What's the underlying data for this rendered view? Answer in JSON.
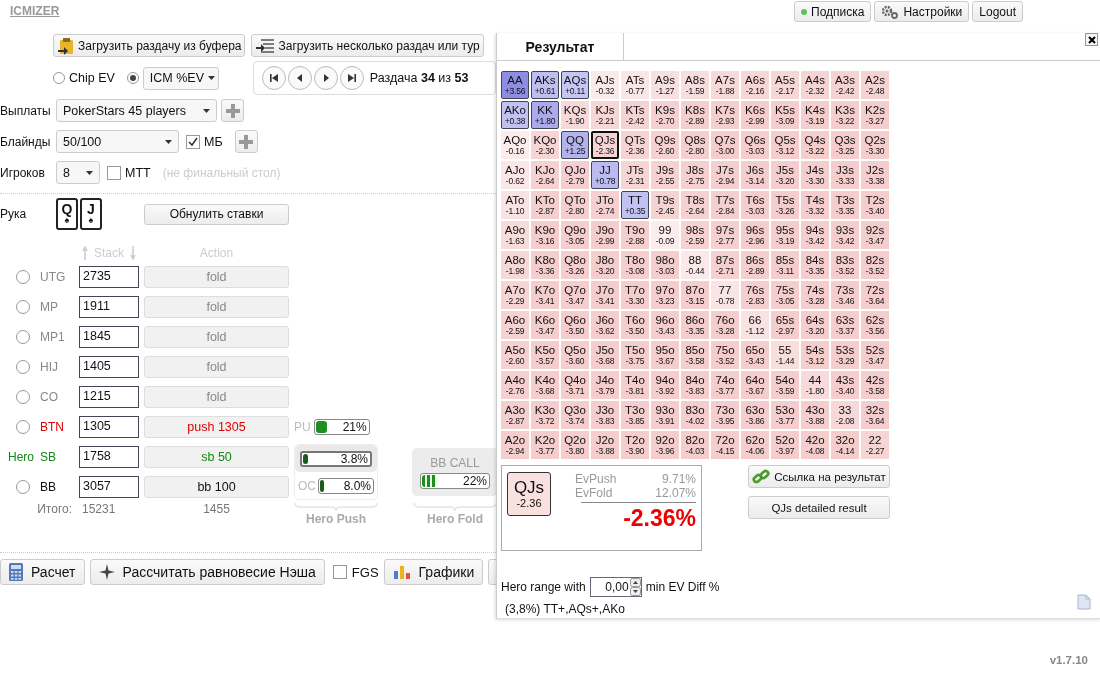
{
  "app": {
    "logo": "ICMIZER",
    "version": "v1.7.10"
  },
  "header_buttons": [
    {
      "label": "Подписка",
      "kind": "subscription"
    },
    {
      "label": "Настройки",
      "kind": "settings"
    },
    {
      "label": "Logout",
      "kind": "plain"
    }
  ],
  "load_buttons": [
    {
      "label": "Загрузить раздачу из буфера",
      "kind": "clipboard"
    },
    {
      "label": "Загрузить несколько раздач или тур",
      "kind": "list"
    }
  ],
  "ev_modes": [
    {
      "label": "Chip EV",
      "selected": false,
      "kind": "radio"
    },
    {
      "label": "ICM %EV",
      "selected": true,
      "kind": "dropdown"
    }
  ],
  "hand_nav": {
    "text": "Раздача **34** из **53**"
  },
  "payouts": {
    "label": "Выплаты",
    "value": "PokerStars 45 players"
  },
  "blinds": {
    "label": "Блайнды",
    "value": "50/100",
    "option": {
      "label": "МБ",
      "checked": true
    }
  },
  "players_count": {
    "label": "Игроков",
    "value": "8",
    "option": {
      "label": "MTT",
      "checked": false
    },
    "note": "(не финальный стол)"
  },
  "hand": {
    "label": "Рука",
    "cards": [
      {
        "rank": "Q",
        "suit": "♠"
      },
      {
        "rank": "J",
        "suit": "♠"
      }
    ],
    "reset_button": "Обнулить ставки"
  },
  "table": {
    "columns": [
      "Stack",
      "Action"
    ],
    "players": [
      {
        "position": "UTG",
        "stack": "2735",
        "action": "fold",
        "color": "#888888",
        "selected": false
      },
      {
        "position": "MP",
        "stack": "1911",
        "action": "fold",
        "color": "#888888",
        "selected": false
      },
      {
        "position": "MP1",
        "stack": "1845",
        "action": "fold",
        "color": "#888888",
        "selected": false
      },
      {
        "position": "HIJ",
        "stack": "1405",
        "action": "fold",
        "color": "#888888",
        "selected": false
      },
      {
        "position": "CO",
        "stack": "1215",
        "action": "fold",
        "color": "#888888",
        "selected": false
      },
      {
        "position": "BTN",
        "stack": "1305",
        "action": "push 1305",
        "color": "#e00000",
        "selected": false,
        "kind": "pusher"
      },
      {
        "position": "SB",
        "hero_label": "Hero",
        "stack": "1758",
        "action": "sb 50",
        "color": "#118811",
        "kind": "hero"
      },
      {
        "position": "BB",
        "stack": "3057",
        "action": "bb 100",
        "color": "#111111",
        "selected": false
      }
    ],
    "totals": {
      "label": "Итого:",
      "stack": "15231",
      "pot": "1455"
    }
  },
  "hero_push": {
    "title": "Hero Push",
    "range": {
      "label": "PU",
      "value": "21%",
      "level": 0.21
    },
    "push": {
      "value": "3.8%",
      "level": 0.038
    },
    "call": {
      "label": "OC",
      "value": "8.0%",
      "level": 0.08
    }
  },
  "hero_fold": {
    "title": "Hero Fold",
    "call": {
      "label": "BB CALL",
      "value": "22%",
      "level": 0.22
    }
  },
  "bottom_buttons": [
    {
      "label": "Расчет",
      "kind": "calculator"
    },
    {
      "label": "Рассчитать равновесие Нэша",
      "kind": "nash"
    },
    {
      "label": "FGS",
      "kind": "checkbox",
      "checked": false
    },
    {
      "label": "Графики",
      "kind": "charts"
    },
    {
      "kind": "export"
    }
  ],
  "result": {
    "tab": {
      "label": "Результат",
      "selected": true
    },
    "grid": [
      [
        {
          "h": "AA",
          "ev": "+3.56",
          "in_range": true,
          "selected": false
        },
        {
          "h": "AKs",
          "ev": "+0.61",
          "in_range": true,
          "selected": false
        },
        {
          "h": "AQs",
          "ev": "+0.11",
          "in_range": true,
          "selected": false
        },
        {
          "h": "AJs",
          "ev": "-0.32",
          "in_range": false,
          "selected": false
        },
        {
          "h": "ATs",
          "ev": "-0.77",
          "in_range": false,
          "selected": false
        },
        {
          "h": "A9s",
          "ev": "-1.27",
          "in_range": false,
          "selected": false
        },
        {
          "h": "A8s",
          "ev": "-1.59",
          "in_range": false,
          "selected": false
        },
        {
          "h": "A7s",
          "ev": "-1.88",
          "in_range": false,
          "selected": false
        },
        {
          "h": "A6s",
          "ev": "-2.16",
          "in_range": false,
          "selected": false
        },
        {
          "h": "A5s",
          "ev": "-2.17",
          "in_range": false,
          "selected": false
        },
        {
          "h": "A4s",
          "ev": "-2.32",
          "in_range": false,
          "selected": false
        },
        {
          "h": "A3s",
          "ev": "-2.42",
          "in_range": false,
          "selected": false
        },
        {
          "h": "A2s",
          "ev": "-2.48",
          "in_range": false,
          "selected": false
        }
      ],
      [
        {
          "h": "AKo",
          "ev": "+0.38",
          "in_range": true,
          "selected": false
        },
        {
          "h": "KK",
          "ev": "+1.80",
          "in_range": true,
          "selected": false
        },
        {
          "h": "KQs",
          "ev": "-1.90",
          "in_range": false,
          "selected": false
        },
        {
          "h": "KJs",
          "ev": "-2.21",
          "in_range": false,
          "selected": false
        },
        {
          "h": "KTs",
          "ev": "-2.42",
          "in_range": false,
          "selected": false
        },
        {
          "h": "K9s",
          "ev": "-2.70",
          "in_range": false,
          "selected": false
        },
        {
          "h": "K8s",
          "ev": "-2.89",
          "in_range": false,
          "selected": false
        },
        {
          "h": "K7s",
          "ev": "-2.93",
          "in_range": false,
          "selected": false
        },
        {
          "h": "K6s",
          "ev": "-2.99",
          "in_range": false,
          "selected": false
        },
        {
          "h": "K5s",
          "ev": "-3.09",
          "in_range": false,
          "selected": false
        },
        {
          "h": "K4s",
          "ev": "-3.19",
          "in_range": false,
          "selected": false
        },
        {
          "h": "K3s",
          "ev": "-3.22",
          "in_range": false,
          "selected": false
        },
        {
          "h": "K2s",
          "ev": "-3.27",
          "in_range": false,
          "selected": false
        }
      ],
      [
        {
          "h": "AQo",
          "ev": "-0.16",
          "in_range": false,
          "selected": false
        },
        {
          "h": "KQo",
          "ev": "-2.30",
          "in_range": false,
          "selected": false
        },
        {
          "h": "QQ",
          "ev": "+1.25",
          "in_range": true,
          "selected": false
        },
        {
          "h": "QJs",
          "ev": "-2.36",
          "in_range": false,
          "selected": true
        },
        {
          "h": "QTs",
          "ev": "-2.36",
          "in_range": false,
          "selected": false
        },
        {
          "h": "Q9s",
          "ev": "-2.60",
          "in_range": false,
          "selected": false
        },
        {
          "h": "Q8s",
          "ev": "-2.80",
          "in_range": false,
          "selected": false
        },
        {
          "h": "Q7s",
          "ev": "-3.00",
          "in_range": false,
          "selected": false
        },
        {
          "h": "Q6s",
          "ev": "-3.03",
          "in_range": false,
          "selected": false
        },
        {
          "h": "Q5s",
          "ev": "-3.12",
          "in_range": false,
          "selected": false
        },
        {
          "h": "Q4s",
          "ev": "-3.22",
          "in_range": false,
          "selected": false
        },
        {
          "h": "Q3s",
          "ev": "-3.25",
          "in_range": false,
          "selected": false
        },
        {
          "h": "Q2s",
          "ev": "-3.30",
          "in_range": false,
          "selected": false
        }
      ],
      [
        {
          "h": "AJo",
          "ev": "-0.62",
          "in_range": false,
          "selected": false
        },
        {
          "h": "KJo",
          "ev": "-2.64",
          "in_range": false,
          "selected": false
        },
        {
          "h": "QJo",
          "ev": "-2.79",
          "in_range": false,
          "selected": false
        },
        {
          "h": "JJ",
          "ev": "+0.78",
          "in_range": true,
          "selected": false
        },
        {
          "h": "JTs",
          "ev": "-2.31",
          "in_range": false,
          "selected": false
        },
        {
          "h": "J9s",
          "ev": "-2.55",
          "in_range": false,
          "selected": false
        },
        {
          "h": "J8s",
          "ev": "-2.75",
          "in_range": false,
          "selected": false
        },
        {
          "h": "J7s",
          "ev": "-2.94",
          "in_range": false,
          "selected": false
        },
        {
          "h": "J6s",
          "ev": "-3.14",
          "in_range": false,
          "selected": false
        },
        {
          "h": "J5s",
          "ev": "-3.20",
          "in_range": false,
          "selected": false
        },
        {
          "h": "J4s",
          "ev": "-3.30",
          "in_range": false,
          "selected": false
        },
        {
          "h": "J3s",
          "ev": "-3.33",
          "in_range": false,
          "selected": false
        },
        {
          "h": "J2s",
          "ev": "-3.38",
          "in_range": false,
          "selected": false
        }
      ],
      [
        {
          "h": "ATo",
          "ev": "-1.10",
          "in_range": false,
          "selected": false
        },
        {
          "h": "KTo",
          "ev": "-2.87",
          "in_range": false,
          "selected": false
        },
        {
          "h": "QTo",
          "ev": "-2.80",
          "in_range": false,
          "selected": false
        },
        {
          "h": "JTo",
          "ev": "-2.74",
          "in_range": false,
          "selected": false
        },
        {
          "h": "TT",
          "ev": "+0.35",
          "in_range": true,
          "selected": false
        },
        {
          "h": "T9s",
          "ev": "-2.45",
          "in_range": false,
          "selected": false
        },
        {
          "h": "T8s",
          "ev": "-2.64",
          "in_range": false,
          "selected": false
        },
        {
          "h": "T7s",
          "ev": "-2.84",
          "in_range": false,
          "selected": false
        },
        {
          "h": "T6s",
          "ev": "-3.03",
          "in_range": false,
          "selected": false
        },
        {
          "h": "T5s",
          "ev": "-3.26",
          "in_range": false,
          "selected": false
        },
        {
          "h": "T4s",
          "ev": "-3.32",
          "in_range": false,
          "selected": false
        },
        {
          "h": "T3s",
          "ev": "-3.35",
          "in_range": false,
          "selected": false
        },
        {
          "h": "T2s",
          "ev": "-3.40",
          "in_range": false,
          "selected": false
        }
      ],
      [
        {
          "h": "A9o",
          "ev": "-1.63",
          "in_range": false,
          "selected": false
        },
        {
          "h": "K9o",
          "ev": "-3.16",
          "in_range": false,
          "selected": false
        },
        {
          "h": "Q9o",
          "ev": "-3.05",
          "in_range": false,
          "selected": false
        },
        {
          "h": "J9o",
          "ev": "-2.99",
          "in_range": false,
          "selected": false
        },
        {
          "h": "T9o",
          "ev": "-2.88",
          "in_range": false,
          "selected": false
        },
        {
          "h": "99",
          "ev": "-0.09",
          "in_range": false,
          "selected": false
        },
        {
          "h": "98s",
          "ev": "-2.59",
          "in_range": false,
          "selected": false
        },
        {
          "h": "97s",
          "ev": "-2.77",
          "in_range": false,
          "selected": false
        },
        {
          "h": "96s",
          "ev": "-2.96",
          "in_range": false,
          "selected": false
        },
        {
          "h": "95s",
          "ev": "-3.19",
          "in_range": false,
          "selected": false
        },
        {
          "h": "94s",
          "ev": "-3.42",
          "in_range": false,
          "selected": false
        },
        {
          "h": "93s",
          "ev": "-3.42",
          "in_range": false,
          "selected": false
        },
        {
          "h": "92s",
          "ev": "-3.47",
          "in_range": false,
          "selected": false
        }
      ],
      [
        {
          "h": "A8o",
          "ev": "-1.98",
          "in_range": false,
          "selected": false
        },
        {
          "h": "K8o",
          "ev": "-3.36",
          "in_range": false,
          "selected": false
        },
        {
          "h": "Q8o",
          "ev": "-3.26",
          "in_range": false,
          "selected": false
        },
        {
          "h": "J8o",
          "ev": "-3.20",
          "in_range": false,
          "selected": false
        },
        {
          "h": "T8o",
          "ev": "-3.08",
          "in_range": false,
          "selected": false
        },
        {
          "h": "98o",
          "ev": "-3.03",
          "in_range": false,
          "selected": false
        },
        {
          "h": "88",
          "ev": "-0.44",
          "in_range": false,
          "selected": false
        },
        {
          "h": "87s",
          "ev": "-2.71",
          "in_range": false,
          "selected": false
        },
        {
          "h": "86s",
          "ev": "-2.89",
          "in_range": false,
          "selected": false
        },
        {
          "h": "85s",
          "ev": "-3.11",
          "in_range": false,
          "selected": false
        },
        {
          "h": "84s",
          "ev": "-3.35",
          "in_range": false,
          "selected": false
        },
        {
          "h": "83s",
          "ev": "-3.52",
          "in_range": false,
          "selected": false
        },
        {
          "h": "82s",
          "ev": "-3.52",
          "in_range": false,
          "selected": false
        }
      ],
      [
        {
          "h": "A7o",
          "ev": "-2.29",
          "in_range": false,
          "selected": false
        },
        {
          "h": "K7o",
          "ev": "-3.41",
          "in_range": false,
          "selected": false
        },
        {
          "h": "Q7o",
          "ev": "-3.47",
          "in_range": false,
          "selected": false
        },
        {
          "h": "J7o",
          "ev": "-3.41",
          "in_range": false,
          "selected": false
        },
        {
          "h": "T7o",
          "ev": "-3.30",
          "in_range": false,
          "selected": false
        },
        {
          "h": "97o",
          "ev": "-3.23",
          "in_range": false,
          "selected": false
        },
        {
          "h": "87o",
          "ev": "-3.15",
          "in_range": false,
          "selected": false
        },
        {
          "h": "77",
          "ev": "-0.78",
          "in_range": false,
          "selected": false
        },
        {
          "h": "76s",
          "ev": "-2.83",
          "in_range": false,
          "selected": false
        },
        {
          "h": "75s",
          "ev": "-3.05",
          "in_range": false,
          "selected": false
        },
        {
          "h": "74s",
          "ev": "-3.28",
          "in_range": false,
          "selected": false
        },
        {
          "h": "73s",
          "ev": "-3.46",
          "in_range": false,
          "selected": false
        },
        {
          "h": "72s",
          "ev": "-3.64",
          "in_range": false,
          "selected": false
        }
      ],
      [
        {
          "h": "A6o",
          "ev": "-2.59",
          "in_range": false,
          "selected": false
        },
        {
          "h": "K6o",
          "ev": "-3.47",
          "in_range": false,
          "selected": false
        },
        {
          "h": "Q6o",
          "ev": "-3.50",
          "in_range": false,
          "selected": false
        },
        {
          "h": "J6o",
          "ev": "-3.62",
          "in_range": false,
          "selected": false
        },
        {
          "h": "T6o",
          "ev": "-3.50",
          "in_range": false,
          "selected": false
        },
        {
          "h": "96o",
          "ev": "-3.43",
          "in_range": false,
          "selected": false
        },
        {
          "h": "86o",
          "ev": "-3.35",
          "in_range": false,
          "selected": false
        },
        {
          "h": "76o",
          "ev": "-3.28",
          "in_range": false,
          "selected": false
        },
        {
          "h": "66",
          "ev": "-1.12",
          "in_range": false,
          "selected": false
        },
        {
          "h": "65s",
          "ev": "-2.97",
          "in_range": false,
          "selected": false
        },
        {
          "h": "64s",
          "ev": "-3.20",
          "in_range": false,
          "selected": false
        },
        {
          "h": "63s",
          "ev": "-3.37",
          "in_range": false,
          "selected": false
        },
        {
          "h": "62s",
          "ev": "-3.56",
          "in_range": false,
          "selected": false
        }
      ],
      [
        {
          "h": "A5o",
          "ev": "-2.60",
          "in_range": false,
          "selected": false
        },
        {
          "h": "K5o",
          "ev": "-3.57",
          "in_range": false,
          "selected": false
        },
        {
          "h": "Q5o",
          "ev": "-3.60",
          "in_range": false,
          "selected": false
        },
        {
          "h": "J5o",
          "ev": "-3.68",
          "in_range": false,
          "selected": false
        },
        {
          "h": "T5o",
          "ev": "-3.75",
          "in_range": false,
          "selected": false
        },
        {
          "h": "95o",
          "ev": "-3.67",
          "in_range": false,
          "selected": false
        },
        {
          "h": "85o",
          "ev": "-3.58",
          "in_range": false,
          "selected": false
        },
        {
          "h": "75o",
          "ev": "-3.52",
          "in_range": false,
          "selected": false
        },
        {
          "h": "65o",
          "ev": "-3.43",
          "in_range": false,
          "selected": false
        },
        {
          "h": "55",
          "ev": "-1.44",
          "in_range": false,
          "selected": false
        },
        {
          "h": "54s",
          "ev": "-3.12",
          "in_range": false,
          "selected": false
        },
        {
          "h": "53s",
          "ev": "-3.29",
          "in_range": false,
          "selected": false
        },
        {
          "h": "52s",
          "ev": "-3.47",
          "in_range": false,
          "selected": false
        }
      ],
      [
        {
          "h": "A4o",
          "ev": "-2.76",
          "in_range": false,
          "selected": false
        },
        {
          "h": "K4o",
          "ev": "-3.68",
          "in_range": false,
          "selected": false
        },
        {
          "h": "Q4o",
          "ev": "-3.71",
          "in_range": false,
          "selected": false
        },
        {
          "h": "J4o",
          "ev": "-3.79",
          "in_range": false,
          "selected": false
        },
        {
          "h": "T4o",
          "ev": "-3.81",
          "in_range": false,
          "selected": false
        },
        {
          "h": "94o",
          "ev": "-3.92",
          "in_range": false,
          "selected": false
        },
        {
          "h": "84o",
          "ev": "-3.83",
          "in_range": false,
          "selected": false
        },
        {
          "h": "74o",
          "ev": "-3.77",
          "in_range": false,
          "selected": false
        },
        {
          "h": "64o",
          "ev": "-3.67",
          "in_range": false,
          "selected": false
        },
        {
          "h": "54o",
          "ev": "-3.59",
          "in_range": false,
          "selected": false
        },
        {
          "h": "44",
          "ev": "-1.80",
          "in_range": false,
          "selected": false
        },
        {
          "h": "43s",
          "ev": "-3.40",
          "in_range": false,
          "selected": false
        },
        {
          "h": "42s",
          "ev": "-3.58",
          "in_range": false,
          "selected": false
        }
      ],
      [
        {
          "h": "A3o",
          "ev": "-2.87",
          "in_range": false,
          "selected": false
        },
        {
          "h": "K3o",
          "ev": "-3.72",
          "in_range": false,
          "selected": false
        },
        {
          "h": "Q3o",
          "ev": "-3.74",
          "in_range": false,
          "selected": false
        },
        {
          "h": "J3o",
          "ev": "-3.83",
          "in_range": false,
          "selected": false
        },
        {
          "h": "T3o",
          "ev": "-3.85",
          "in_range": false,
          "selected": false
        },
        {
          "h": "93o",
          "ev": "-3.91",
          "in_range": false,
          "selected": false
        },
        {
          "h": "83o",
          "ev": "-4.02",
          "in_range": false,
          "selected": false
        },
        {
          "h": "73o",
          "ev": "-3.95",
          "in_range": false,
          "selected": false
        },
        {
          "h": "63o",
          "ev": "-3.86",
          "in_range": false,
          "selected": false
        },
        {
          "h": "53o",
          "ev": "-3.77",
          "in_range": false,
          "selected": false
        },
        {
          "h": "43o",
          "ev": "-3.88",
          "in_range": false,
          "selected": false
        },
        {
          "h": "33",
          "ev": "-2.08",
          "in_range": false,
          "selected": false
        },
        {
          "h": "32s",
          "ev": "-3.64",
          "in_range": false,
          "selected": false
        }
      ],
      [
        {
          "h": "A2o",
          "ev": "-2.94",
          "in_range": false,
          "selected": false
        },
        {
          "h": "K2o",
          "ev": "-3.77",
          "in_range": false,
          "selected": false
        },
        {
          "h": "Q2o",
          "ev": "-3.80",
          "in_range": false,
          "selected": false
        },
        {
          "h": "J2o",
          "ev": "-3.88",
          "in_range": false,
          "selected": false
        },
        {
          "h": "T2o",
          "ev": "-3.90",
          "in_range": false,
          "selected": false
        },
        {
          "h": "92o",
          "ev": "-3.96",
          "in_range": false,
          "selected": false
        },
        {
          "h": "82o",
          "ev": "-4.03",
          "in_range": false,
          "selected": false
        },
        {
          "h": "72o",
          "ev": "-4.15",
          "in_range": false,
          "selected": false
        },
        {
          "h": "62o",
          "ev": "-4.06",
          "in_range": false,
          "selected": false
        },
        {
          "h": "52o",
          "ev": "-3.97",
          "in_range": false,
          "selected": false
        },
        {
          "h": "42o",
          "ev": "-4.08",
          "in_range": false,
          "selected": false
        },
        {
          "h": "32o",
          "ev": "-4.14",
          "in_range": false,
          "selected": false
        },
        {
          "h": "22",
          "ev": "-2.27",
          "in_range": false,
          "selected": false
        }
      ]
    ],
    "detail": {
      "hand": "QJs",
      "ev": "-2.36",
      "ev_push_label": "EvPush",
      "ev_push": "9.71%",
      "ev_fold_label": "EvFold",
      "ev_fold": "12.07%",
      "diff": "-2.36%"
    },
    "link_button": "Ссылка на результат",
    "detail_button": "QJs detailed result",
    "range_filter": {
      "prefix": "Hero range with",
      "value": "0,00",
      "suffix": "min EV Diff %"
    },
    "range_text": "(3,8%) TT+,AQs+,AKo"
  }
}
